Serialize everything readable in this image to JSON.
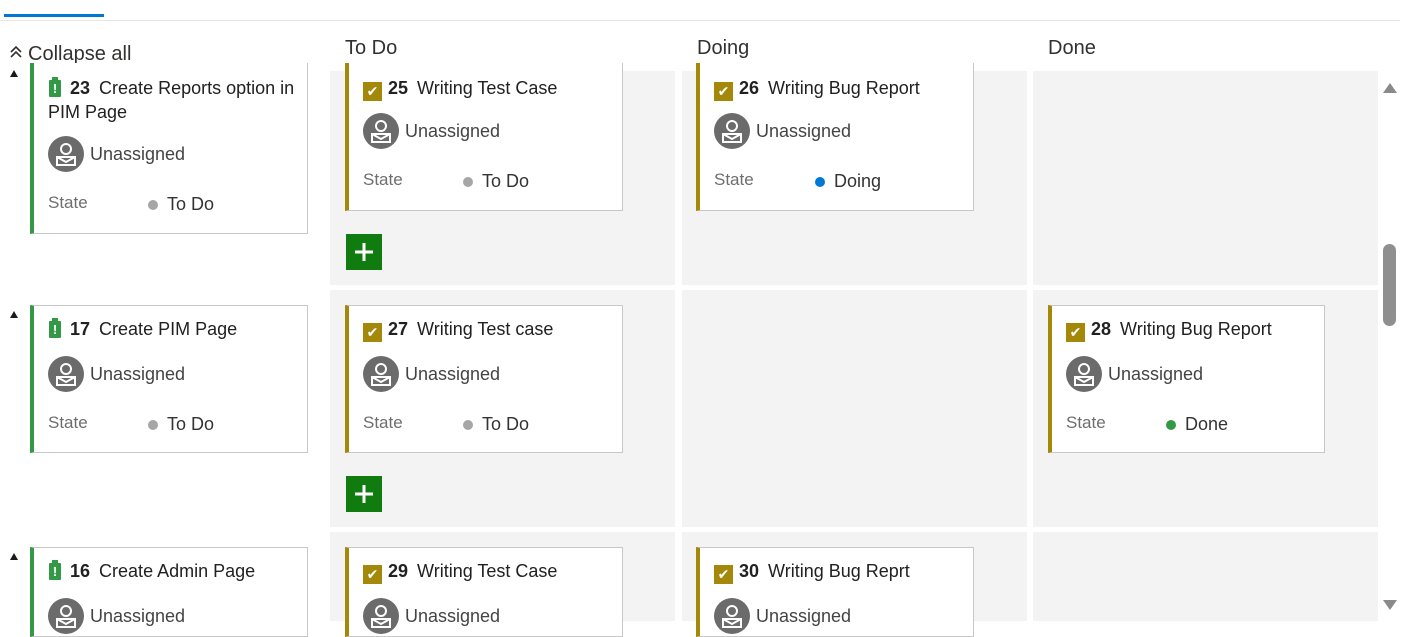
{
  "toolbar": {
    "collapse_all_label": "Collapse all"
  },
  "columns": [
    {
      "name": "To Do"
    },
    {
      "name": "Doing"
    },
    {
      "name": "Done"
    }
  ],
  "state_label": "State",
  "state_colors": {
    "To Do": "#a6a6a6",
    "Doing": "#0078d4",
    "Done": "#339947"
  },
  "lanes": [
    {
      "parent": {
        "id": "23",
        "title": "Create Reports option in PIM Page",
        "assignee": "Unassigned",
        "state": "To Do",
        "type_icon": "product-backlog-item-icon"
      },
      "todo": {
        "id": "25",
        "title": "Writing Test Case",
        "assignee": "Unassigned",
        "state": "To Do",
        "type_icon": "task-check-icon"
      },
      "doing": {
        "id": "26",
        "title": "Writing Bug Report",
        "assignee": "Unassigned",
        "state": "Doing",
        "type_icon": "task-check-icon"
      }
    },
    {
      "parent": {
        "id": "17",
        "title": "Create PIM Page",
        "assignee": "Unassigned",
        "state": "To Do",
        "type_icon": "product-backlog-item-icon"
      },
      "todo": {
        "id": "27",
        "title": "Writing Test case",
        "assignee": "Unassigned",
        "state": "To Do",
        "type_icon": "task-check-icon"
      },
      "done": {
        "id": "28",
        "title": "Writing Bug Report",
        "assignee": "Unassigned",
        "state": "Done",
        "type_icon": "task-check-icon"
      }
    },
    {
      "parent": {
        "id": "16",
        "title": "Create Admin Page",
        "assignee": "Unassigned",
        "type_icon": "product-backlog-item-icon"
      },
      "todo": {
        "id": "29",
        "title": "Writing Test Case",
        "assignee": "Unassigned",
        "type_icon": "task-check-icon"
      },
      "doing": {
        "id": "30",
        "title": "Writing Bug Reprt",
        "assignee": "Unassigned",
        "type_icon": "task-check-icon"
      }
    }
  ],
  "accent_colors": {
    "task": "#a4880a",
    "pbi": "#339947",
    "add": "#107c10",
    "tab_underline": "#0078d4"
  }
}
